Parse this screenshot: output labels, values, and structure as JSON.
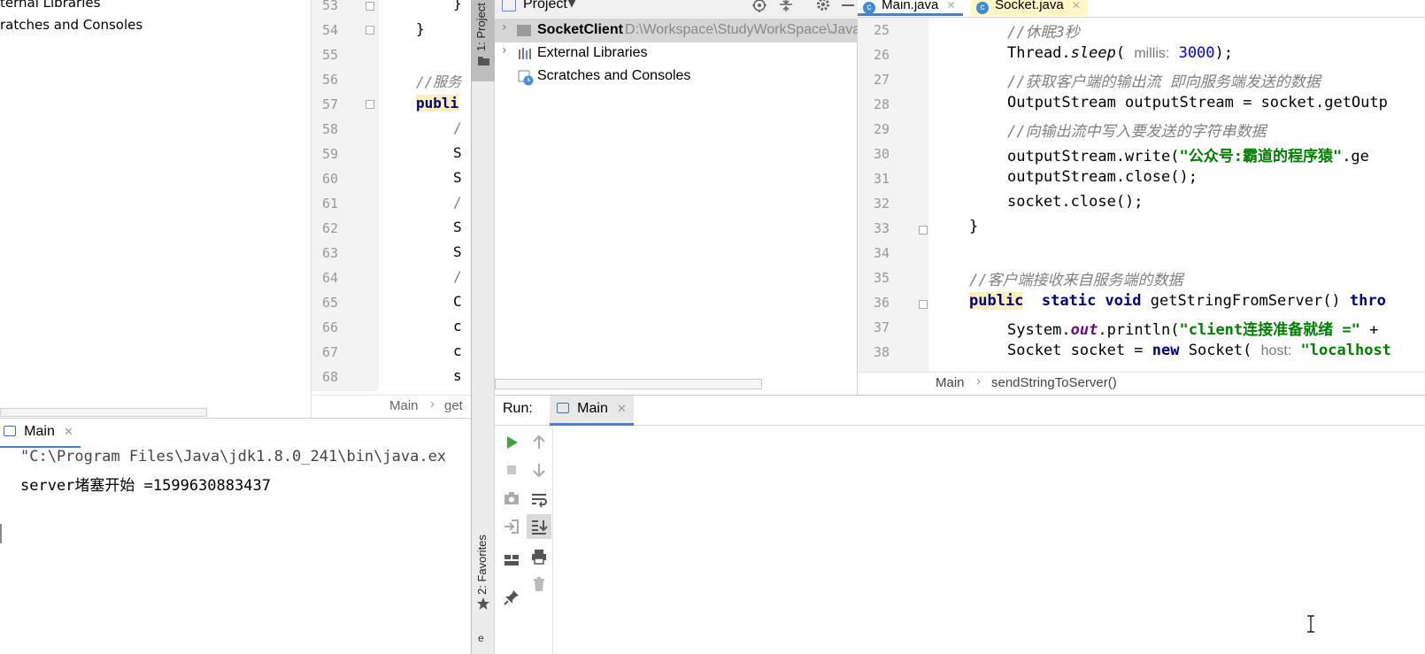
{
  "left_window": {
    "tree": {
      "items": [
        "ternal Libraries",
        "ratches and Consoles"
      ]
    },
    "editor": {
      "lines": [
        {
          "num": "53",
          "code": "}"
        },
        {
          "num": "54",
          "code": "}"
        },
        {
          "num": "55",
          "code": ""
        },
        {
          "num": "56",
          "code": "//服务"
        },
        {
          "num": "57",
          "code": "publi"
        },
        {
          "num": "58",
          "code": "/"
        },
        {
          "num": "59",
          "code": "S"
        },
        {
          "num": "60",
          "code": "S"
        },
        {
          "num": "61",
          "code": "/"
        },
        {
          "num": "62",
          "code": "S"
        },
        {
          "num": "63",
          "code": "S"
        },
        {
          "num": "64",
          "code": "/"
        },
        {
          "num": "65",
          "code": "C"
        },
        {
          "num": "66",
          "code": "c"
        },
        {
          "num": "67",
          "code": "c"
        },
        {
          "num": "68",
          "code": "s"
        }
      ],
      "breadcrumb": [
        "Main",
        "get"
      ]
    },
    "run": {
      "tab_label": "Main",
      "console_lines": [
        "\"C:\\Program Files\\Java\\jdk1.8.0_241\\bin\\java.ex",
        "server堵塞开始 =1599630883437"
      ]
    }
  },
  "sidebar": {
    "project_tool_label": "1: Project",
    "favorites_tool_label": "2: Favorites"
  },
  "project_panel": {
    "title": "Project",
    "items": [
      {
        "label": "SocketClient",
        "path": "D:\\Workspace\\StudyWorkSpace\\Java",
        "bold": true
      },
      {
        "label": "External Libraries"
      },
      {
        "label": "Scratches and Consoles"
      }
    ]
  },
  "editor": {
    "tabs": [
      {
        "label": "Main.java",
        "active": true
      },
      {
        "label": "Socket.java",
        "active": false
      }
    ],
    "lines": [
      {
        "num": "25",
        "text": "//休眠3秒"
      },
      {
        "num": "26",
        "text": "Thread.sleep( millis: 3000);"
      },
      {
        "num": "27",
        "text": "//获取客户端的输出流 即向服务端发送的数据"
      },
      {
        "num": "28",
        "text": "OutputStream outputStream = socket.getOutp"
      },
      {
        "num": "29",
        "text": "//向输出流中写入要发送的字符串数据"
      },
      {
        "num": "30",
        "text": "outputStream.write(\"公众号:霸道的程序猿\".ge"
      },
      {
        "num": "31",
        "text": "outputStream.close();"
      },
      {
        "num": "32",
        "text": "socket.close();"
      },
      {
        "num": "33",
        "text": "}"
      },
      {
        "num": "34",
        "text": ""
      },
      {
        "num": "35",
        "text": "//客户端接收来自服务端的数据"
      },
      {
        "num": "36",
        "text": "public  static void getStringFromServer() thro"
      },
      {
        "num": "37",
        "text": "System.out.println(\"client连接准备就绪 =\" +"
      },
      {
        "num": "38",
        "text": "Socket socket = new Socket( host: \"localhost"
      }
    ],
    "tokens": {
      "c25": "//休眠3秒",
      "t26a": "Thread.",
      "t26b": "sleep",
      "t26c": "( ",
      "t26d": "millis:",
      "t26e": " ",
      "t26f": "3000",
      "t26g": ");",
      "c27": "//获取客户端的输出流 即向服务端发送的数据",
      "t28": "OutputStream outputStream = socket.getOutp",
      "c29": "//向输出流中写入要发送的字符串数据",
      "t30a": "outputStream.write(",
      "t30b": "\"公众号:霸道的程序猿\"",
      "t30c": ".ge",
      "t31": "outputStream.close();",
      "t32": "socket.close();",
      "t33": "}",
      "c35": "//客户端接收来自服务端的数据",
      "t36a": "public",
      "t36b": "  ",
      "t36c": "static void",
      "t36d": " getStringFromServer() ",
      "t36e": "thro",
      "t37a": "System.",
      "t37b": "out",
      "t37c": ".println(",
      "t37d": "\"client连接准备就绪 =\"",
      "t37e": " +",
      "t38a": "Socket socket = ",
      "t38b": "new",
      "t38c": " Socket( ",
      "t38d": "host:",
      "t38e": " ",
      "t38f": "\"localhost"
    },
    "breadcrumb": [
      "Main",
      "sendStringToServer()"
    ]
  },
  "run_panel": {
    "label": "Run:",
    "tab_label": "Main",
    "console_lines": []
  },
  "icons": {
    "run": "run-icon",
    "stop": "stop-icon",
    "camera": "camera-icon",
    "login": "login-icon",
    "layout": "layout-icon",
    "pin": "pin-icon",
    "up": "up-arrow-icon",
    "down": "down-arrow-icon",
    "wrap": "soft-wrap-icon",
    "scroll_end": "scroll-to-end-icon",
    "print": "print-icon",
    "trash": "trash-icon",
    "star": "star-icon"
  },
  "colors": {
    "keyword": "#000080",
    "string": "#008000",
    "number": "#0000ff",
    "comment": "#808080",
    "highlight": "#fbf1b8",
    "run_green": "#3fa43f",
    "tab_underline": "#4d7fc7"
  }
}
